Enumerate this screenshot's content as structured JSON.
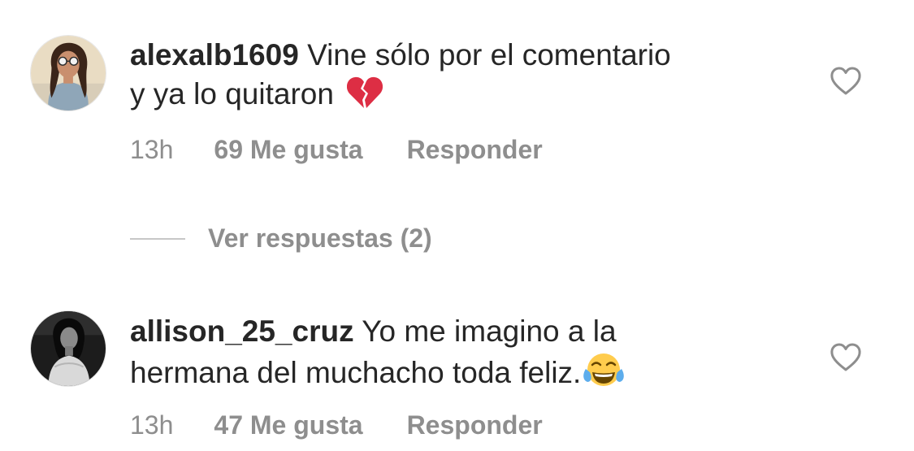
{
  "comments": [
    {
      "username": "alexalb1609",
      "text_line1": "Vine sólo por el comentario",
      "text_line2": "y ya lo quitaron",
      "emoji": "broken-heart-icon",
      "time": "13h",
      "likes": "69 Me gusta",
      "reply": "Responder"
    },
    {
      "username": "allison_25_cruz",
      "text_line1": "Yo me imagino a la",
      "text_line2": "hermana del muchacho toda feliz.",
      "emoji": "tears-of-joy-icon",
      "time": "13h",
      "likes": "47 Me gusta",
      "reply": "Responder"
    }
  ],
  "view_replies": "Ver respuestas (2)",
  "colors": {
    "text": "#262626",
    "secondary": "#8e8e8e",
    "divider": "#c7c7c7",
    "heart_outline": "#8e8e8e",
    "broken_heart": "#dd2e44",
    "emoji_face": "#ffcc4d",
    "tears": "#5dadec"
  }
}
